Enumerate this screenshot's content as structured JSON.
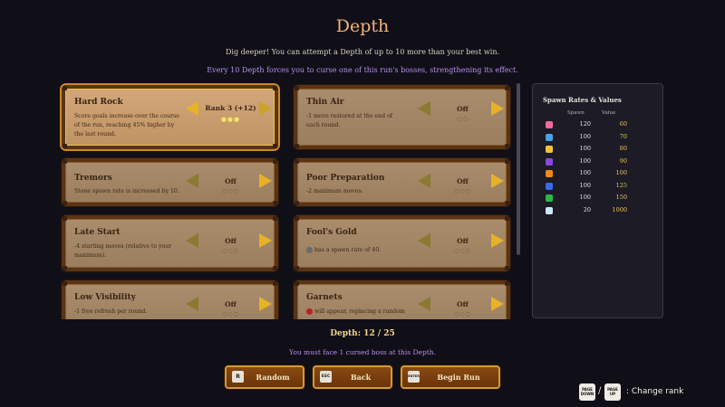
{
  "header": {
    "title": "Depth",
    "subtitle": "Dig deeper! You can attempt a Depth of up to 10 more than your best win.",
    "note": "Every 10 Depth forces you to curse one of this run's bosses, strengthening its effect."
  },
  "cards": [
    {
      "title": "Hard Rock",
      "desc": "Score goals increase over the course of the run, reaching 45% higher by the last round.",
      "state": "Rank 3  (+12)",
      "dots": "●●●"
    },
    {
      "title": "Thin Air",
      "desc": "-1 move restored at the end of each round.",
      "state": "Off",
      "dots": "○○"
    },
    {
      "title": "Tremors",
      "desc": "Stone spawn rate is increased by 10.",
      "state": "Off",
      "dots": "○○○"
    },
    {
      "title": "Poor Preparation",
      "desc": "-2 maximum moves.",
      "state": "Off",
      "dots": "○○○"
    },
    {
      "title": "Late Start",
      "desc": "-4 starting moves (relative to your maximum).",
      "state": "Off",
      "dots": "○○○"
    },
    {
      "title": "Fool's Gold",
      "desc": "has a spawn rate of 40.",
      "state": "Off",
      "dots": "○○○"
    },
    {
      "title": "Low Visibility",
      "desc": "-1 free refresh per round.",
      "state": "Off",
      "dots": "○○○"
    },
    {
      "title": "Garnets",
      "desc": "will appear, replacing a random",
      "state": "Off",
      "dots": "○○○"
    }
  ],
  "rates": {
    "title": "Spawn Rates & Values",
    "spawn_header": "Spawn",
    "value_header": "Value",
    "rows": [
      {
        "spawn": "120",
        "value": "60",
        "color": "#f06a9a"
      },
      {
        "spawn": "100",
        "value": "70",
        "color": "#4aa3e8"
      },
      {
        "spawn": "100",
        "value": "80",
        "color": "#f0c23a"
      },
      {
        "spawn": "100",
        "value": "90",
        "color": "#8a4ae0"
      },
      {
        "spawn": "100",
        "value": "100",
        "color": "#f08a1a"
      },
      {
        "spawn": "100",
        "value": "125",
        "color": "#3a6ae8"
      },
      {
        "spawn": "100",
        "value": "150",
        "color": "#2ab84a"
      },
      {
        "spawn": "20",
        "value": "1000",
        "color": "#cfe8f8"
      }
    ]
  },
  "depth": {
    "label": "Depth: 12 / 25",
    "cursed_note": "You must face 1 cursed boss at this Depth."
  },
  "buttons": {
    "random_key": "R",
    "random": "Random",
    "back_key": "ESC",
    "back": "Back",
    "begin_key": "ENTER",
    "begin": "Begin Run"
  },
  "hint": {
    "page_down": "PAGE DOWN",
    "page_up": "PAGE UP",
    "slash": "/",
    "text": ": Change rank"
  }
}
